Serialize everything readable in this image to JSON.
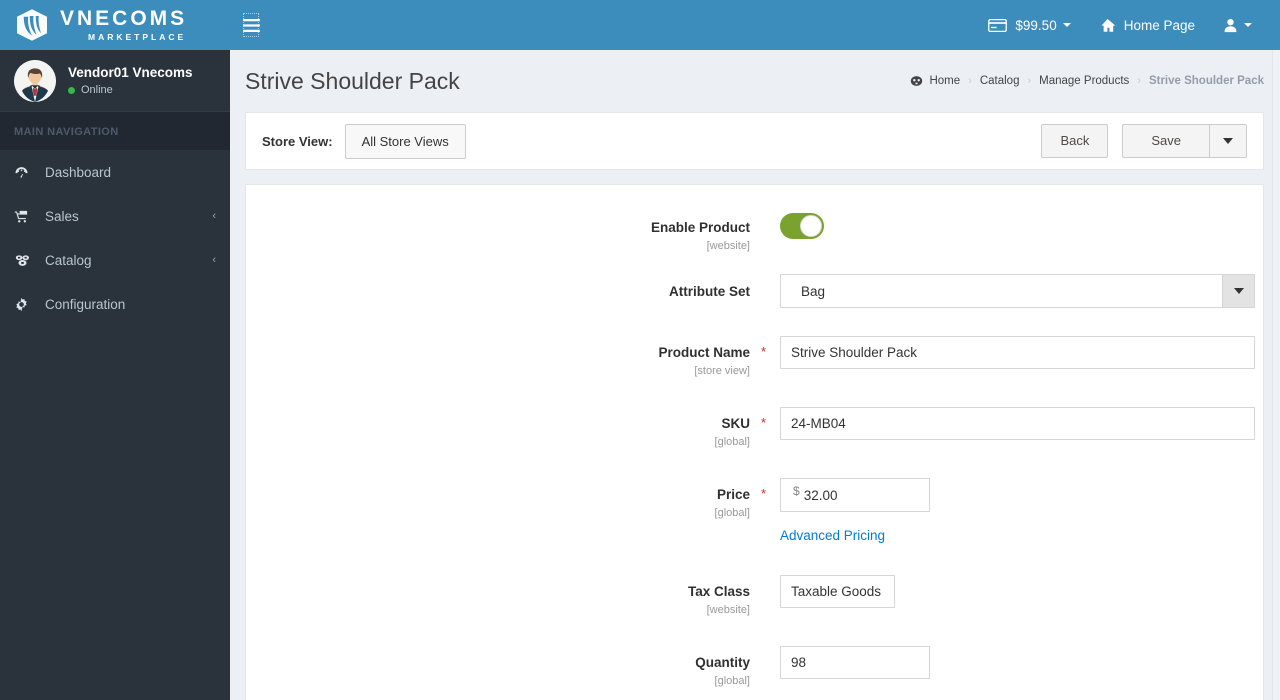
{
  "brand": {
    "name": "VNECOMS",
    "tagline": "MARKETPLACE",
    "logo_icon": "stacked-layers-logo",
    "header_color": "#3c8dbc",
    "sidebar_color": "#2a323c"
  },
  "sidebar": {
    "user": {
      "name": "Vendor01 Vnecoms",
      "status": "Online",
      "status_color": "#3ab54a",
      "avatar_icon": "user-avatar"
    },
    "nav_header": "MAIN NAVIGATION",
    "items": [
      {
        "label": "Dashboard",
        "icon": "dashboard-icon",
        "has_caret": false,
        "caret": ""
      },
      {
        "label": "Sales",
        "icon": "cart-icon",
        "has_caret": true,
        "caret": "‹"
      },
      {
        "label": "Catalog",
        "icon": "catalog-icon",
        "has_caret": true,
        "caret": "‹"
      },
      {
        "label": "Configuration",
        "icon": "gear-icon",
        "has_caret": false,
        "caret": ""
      }
    ]
  },
  "topbar": {
    "menu_toggle_icon": "hamburger-icon",
    "items": [
      {
        "label": "$99.50",
        "icon": "credit-card-icon",
        "has_caret": true
      },
      {
        "label": "Home Page",
        "icon": "home-icon",
        "has_caret": false
      },
      {
        "label": "",
        "icon": "user-icon",
        "has_caret": true
      }
    ]
  },
  "page": {
    "title": "Strive Shoulder Pack",
    "breadcrumb": [
      {
        "label": "Home",
        "icon": "home-breadcrumb-icon",
        "active": false
      },
      {
        "label": "Catalog",
        "icon": "",
        "active": false
      },
      {
        "label": "Manage Products",
        "icon": "",
        "active": false
      },
      {
        "label": "Strive Shoulder Pack",
        "icon": "",
        "active": true
      }
    ],
    "breadcrumb_separator": "›"
  },
  "storeview_bar": {
    "label": "Store View:",
    "selected": "All Store Views",
    "back_label": "Back",
    "save_label": "Save",
    "save_caret_icon": "caret-down-icon"
  },
  "form": {
    "enable_product": {
      "label": "Enable Product",
      "scope": "[website]",
      "value": "on",
      "toggle_color": "#79a22e"
    },
    "attribute_set": {
      "label": "Attribute Set",
      "scope": "",
      "value": "Bag",
      "arrow_icon": "caret-down-icon"
    },
    "product_name": {
      "label": "Product Name",
      "scope": "[store view]",
      "required": "*",
      "value": "Strive Shoulder Pack"
    },
    "sku": {
      "label": "SKU",
      "scope": "[global]",
      "required": "*",
      "value": "24-MB04"
    },
    "price": {
      "label": "Price",
      "scope": "[global]",
      "required": "*",
      "currency_symbol": "$",
      "value": "32.00",
      "advanced_pricing_label": "Advanced Pricing",
      "link_color": "#007bdb"
    },
    "tax_class": {
      "label": "Tax Class",
      "scope": "[website]",
      "value": "Taxable Goods"
    },
    "quantity": {
      "label": "Quantity",
      "scope": "[global]",
      "value": "98"
    }
  }
}
